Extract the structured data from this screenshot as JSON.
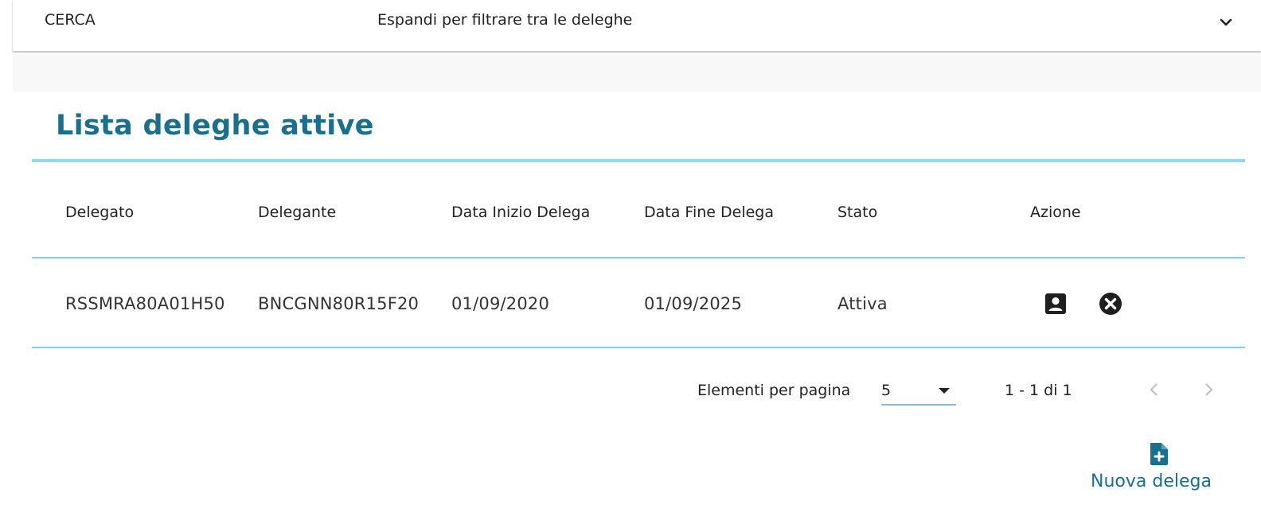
{
  "search": {
    "title": "CERCA",
    "description": "Espandi per filtrare tra le deleghe"
  },
  "page": {
    "title": "Lista deleghe attive"
  },
  "table": {
    "headers": [
      "Delegato",
      "Delegante",
      "Data Inizio Delega",
      "Data Fine Delega",
      "Stato",
      "Azione"
    ],
    "rows": [
      {
        "delegato": "RSSMRA80A01H50",
        "delegante": "BNCGNN80R15F20",
        "data_inizio": "01/09/2020",
        "data_fine": "01/09/2025",
        "stato": "Attiva"
      }
    ],
    "action_icons": [
      "account-box-icon",
      "close-circle-icon"
    ]
  },
  "paginator": {
    "items_per_page_label": "Elementi per pagina",
    "page_size": "5",
    "range_label": "1 - 1 di 1"
  },
  "actions": {
    "new_delega_label": "Nuova delega"
  },
  "colors": {
    "accent": "#17708f",
    "rule": "#8fd8f4",
    "row_line": "#7fd0ef"
  }
}
